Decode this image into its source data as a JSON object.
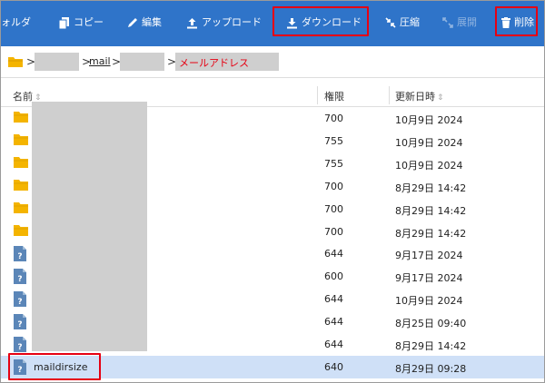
{
  "toolbar": {
    "folder_label": "ォルダ",
    "copy_label": "コピー",
    "edit_label": "編集",
    "upload_label": "アップロード",
    "download_label": "ダウンロード",
    "compress_label": "圧縮",
    "extract_label": "展開",
    "delete_label": "削除"
  },
  "breadcrumb": {
    "mail_label": "mail",
    "current_label": "メールアドレス",
    "separator": ">"
  },
  "table": {
    "headers": {
      "name": "名前",
      "permission": "権限",
      "modified": "更新日時"
    },
    "sort_icon": "⇕",
    "rows": [
      {
        "type": "folder",
        "name": "",
        "permission": "700",
        "modified": "10月9日 2024"
      },
      {
        "type": "folder",
        "name": "",
        "permission": "755",
        "modified": "10月9日 2024"
      },
      {
        "type": "folder",
        "name": "",
        "permission": "755",
        "modified": "10月9日 2024"
      },
      {
        "type": "folder",
        "name": "",
        "permission": "700",
        "modified": "8月29日 14:42"
      },
      {
        "type": "folder",
        "name": "",
        "permission": "700",
        "modified": "8月29日 14:42"
      },
      {
        "type": "folder",
        "name": "",
        "permission": "700",
        "modified": "8月29日 14:42"
      },
      {
        "type": "file",
        "name": "",
        "permission": "644",
        "modified": "9月17日 2024"
      },
      {
        "type": "file",
        "name": "",
        "permission": "600",
        "modified": "9月17日 2024"
      },
      {
        "type": "file",
        "name": "",
        "permission": "644",
        "modified": "10月9日 2024"
      },
      {
        "type": "file",
        "name": "",
        "permission": "644",
        "modified": "8月25日 09:40"
      },
      {
        "type": "file",
        "name": "",
        "permission": "644",
        "modified": "8月29日 14:42"
      },
      {
        "type": "file",
        "name": "maildirsize",
        "permission": "640",
        "modified": "8月29日 09:28"
      }
    ]
  },
  "colors": {
    "toolbar": "#2f74c9",
    "highlight": "#e60012",
    "folder": "#f4b400",
    "file": "#5b86b8",
    "selected_row": "#cfe0f7"
  },
  "icons": [
    "copy-icon",
    "edit-icon",
    "upload-icon",
    "download-icon",
    "compress-icon",
    "extract-icon",
    "trash-icon",
    "home-folder-icon",
    "folder-icon",
    "unknown-file-icon"
  ]
}
